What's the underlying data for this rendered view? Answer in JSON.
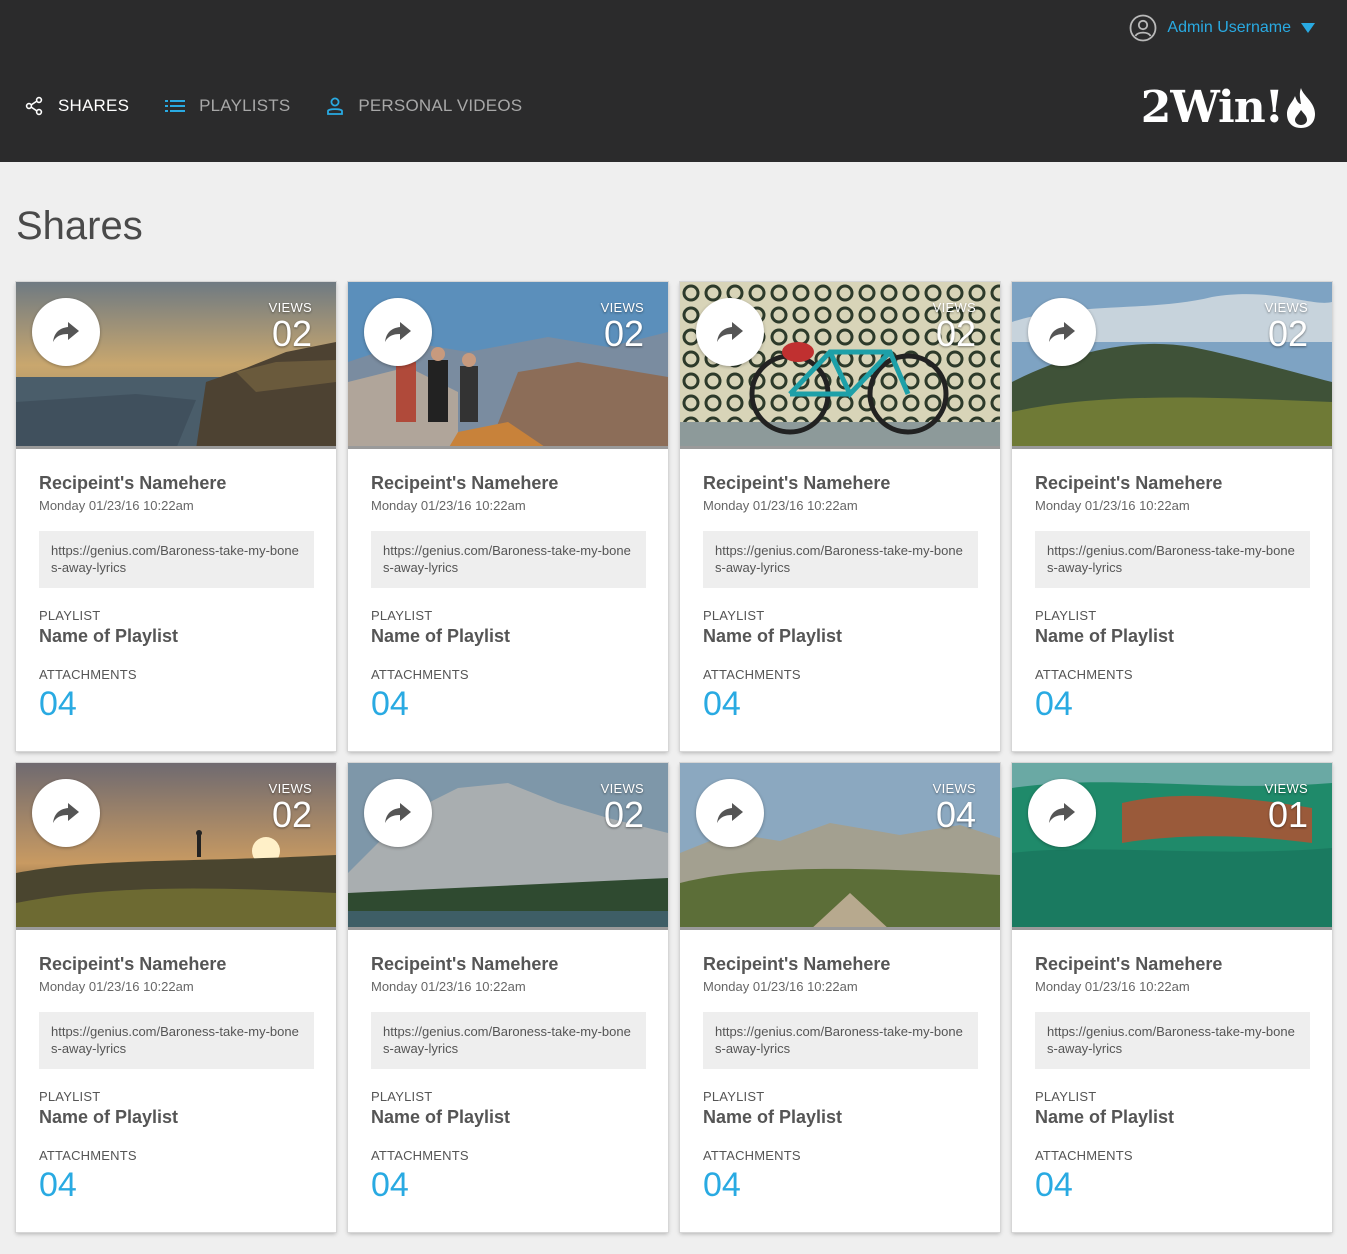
{
  "header": {
    "user_name": "Admin Username",
    "brand": "2Win!",
    "nav": [
      {
        "label": "SHARES",
        "icon": "share-icon",
        "active": true
      },
      {
        "label": "PLAYLISTS",
        "icon": "list-icon",
        "active": false
      },
      {
        "label": "PERSONAL VIDEOS",
        "icon": "person-icon",
        "active": false
      }
    ]
  },
  "page": {
    "title": "Shares"
  },
  "labels": {
    "views": "VIEWS",
    "playlist": "PLAYLIST",
    "attachments": "ATTACHMENTS"
  },
  "colors": {
    "accent": "#29aae2",
    "header_bg": "#2b2b2c",
    "page_bg": "#efefef"
  },
  "cards": [
    {
      "views": "02",
      "recipient": "Recipeint's Namehere",
      "date": "Monday 01/23/16 10:22am",
      "url": "https://genius.com/Baroness-take-my-bones-away-lyrics",
      "playlist": "Name of Playlist",
      "attachments": "04",
      "scene": "coast"
    },
    {
      "views": "02",
      "recipient": "Recipeint's Namehere",
      "date": "Monday 01/23/16 10:22am",
      "url": "https://genius.com/Baroness-take-my-bones-away-lyrics",
      "playlist": "Name of Playlist",
      "attachments": "04",
      "scene": "canyon"
    },
    {
      "views": "02",
      "recipient": "Recipeint's Namehere",
      "date": "Monday 01/23/16 10:22am",
      "url": "https://genius.com/Baroness-take-my-bones-away-lyrics",
      "playlist": "Name of Playlist",
      "attachments": "04",
      "scene": "bicycle"
    },
    {
      "views": "02",
      "recipient": "Recipeint's Namehere",
      "date": "Monday 01/23/16 10:22am",
      "url": "https://genius.com/Baroness-take-my-bones-away-lyrics",
      "playlist": "Name of Playlist",
      "attachments": "04",
      "scene": "hills"
    },
    {
      "views": "02",
      "recipient": "Recipeint's Namehere",
      "date": "Monday 01/23/16 10:22am",
      "url": "https://genius.com/Baroness-take-my-bones-away-lyrics",
      "playlist": "Name of Playlist",
      "attachments": "04",
      "scene": "sunset"
    },
    {
      "views": "02",
      "recipient": "Recipeint's Namehere",
      "date": "Monday 01/23/16 10:22am",
      "url": "https://genius.com/Baroness-take-my-bones-away-lyrics",
      "playlist": "Name of Playlist",
      "attachments": "04",
      "scene": "mountain-lake"
    },
    {
      "views": "04",
      "recipient": "Recipeint's Namehere",
      "date": "Monday 01/23/16 10:22am",
      "url": "https://genius.com/Baroness-take-my-bones-away-lyrics",
      "playlist": "Name of Playlist",
      "attachments": "04",
      "scene": "alpine"
    },
    {
      "views": "01",
      "recipient": "Recipeint's Namehere",
      "date": "Monday 01/23/16 10:22am",
      "url": "https://genius.com/Baroness-take-my-bones-away-lyrics",
      "playlist": "Name of Playlist",
      "attachments": "04",
      "scene": "water"
    }
  ]
}
